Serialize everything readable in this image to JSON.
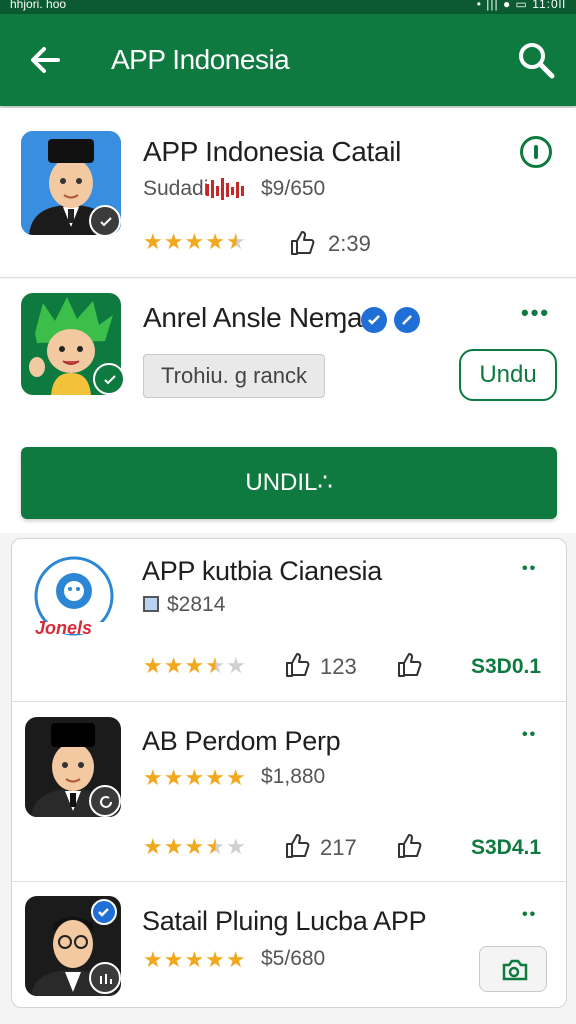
{
  "status_bar": {
    "left": "hhjori. hoo",
    "right": "• ||| ● ▭ 11:0ll"
  },
  "appbar": {
    "title": "APP Indonesia"
  },
  "featured": {
    "name": "APP Indonesia Catail",
    "developer": "Sudadi",
    "price": "$9/650",
    "rating": 4.5,
    "likes": "2:39"
  },
  "second": {
    "name": "Anrel Ansle Neɱa",
    "tag": "Trohiu. g ranck",
    "button": "Undu"
  },
  "main_button": {
    "label": "UNDIL∴"
  },
  "list": [
    {
      "name": "APP kutbia Cianesia",
      "price": "$2814",
      "rating": 3.5,
      "likes": "123",
      "amount": "S3D0.1",
      "logo_text": "Jonels"
    },
    {
      "name": "AB Perdom Perp",
      "price": "$1,880",
      "rating": 3.5,
      "likes": "217",
      "amount": "S3D4.1"
    },
    {
      "name": "Satail Pluing Lucba APP",
      "price": "$5/680"
    }
  ],
  "colors": {
    "primary": "#0e7a3f",
    "star": "#f2a81d",
    "badge_blue": "#1f6fd6"
  }
}
